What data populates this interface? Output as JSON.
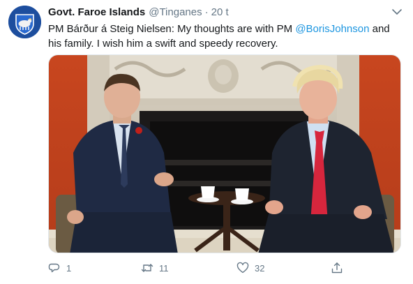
{
  "account": {
    "display_name": "Govt. Faroe Islands",
    "handle": "@Tinganes",
    "separator": "·",
    "time": "20 t",
    "avatar_icon": "ram-coat-of-arms-icon",
    "avatar_color": "#1d4e9e"
  },
  "tweet": {
    "text_before": "PM Bárður á Steig Nielsen: My thoughts are with PM ",
    "mention": "@BorisJohnson",
    "text_after": " and his family. I wish him a swift and speedy recovery.",
    "mention_color": "#1b95e0"
  },
  "media": {
    "icon": "photo-two-men-seated-icon"
  },
  "actions": {
    "reply": {
      "icon": "reply-icon",
      "count": "1"
    },
    "retweet": {
      "icon": "retweet-icon",
      "count": "11"
    },
    "like": {
      "icon": "heart-icon",
      "count": "32"
    },
    "share": {
      "icon": "share-icon",
      "count": ""
    }
  },
  "menu": {
    "icon": "chevron-down-icon"
  }
}
